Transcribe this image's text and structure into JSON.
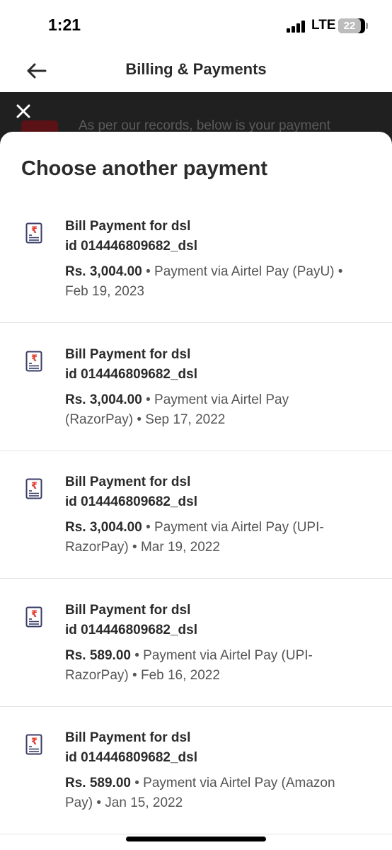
{
  "status": {
    "time": "1:21",
    "network": "LTE",
    "battery": "22"
  },
  "header": {
    "title": "Billing & Payments"
  },
  "banner": {
    "text": "As per our records, below is your payment"
  },
  "sheet": {
    "title": "Choose another payment",
    "items": [
      {
        "title1": "Bill Payment for dsl",
        "title2": "id 014446809682_dsl",
        "amount": "Rs. 3,004.00",
        "line1": " • Payment via Airtel Pay (PayU) •",
        "line2": "Feb 19, 2023"
      },
      {
        "title1": "Bill Payment for dsl",
        "title2": "id 014446809682_dsl",
        "amount": "Rs. 3,004.00",
        "line1": " • Payment via Airtel Pay",
        "line2": "(RazorPay) • Sep 17, 2022"
      },
      {
        "title1": "Bill Payment for dsl",
        "title2": "id 014446809682_dsl",
        "amount": "Rs. 3,004.00",
        "line1": " • Payment via Airtel Pay (UPI-",
        "line2": "RazorPay) • Mar 19, 2022"
      },
      {
        "title1": "Bill Payment for dsl",
        "title2": "id 014446809682_dsl",
        "amount": "Rs. 589.00",
        "line1": " • Payment via Airtel Pay (UPI-",
        "line2": "RazorPay) • Feb 16, 2022"
      },
      {
        "title1": "Bill Payment for dsl",
        "title2": "id 014446809682_dsl",
        "amount": "Rs. 589.00",
        "line1": " • Payment via Airtel Pay (Amazon",
        "line2": "Pay) • Jan 15, 2022"
      }
    ]
  },
  "icons": {
    "back": "arrow-left-icon",
    "close": "close-icon",
    "bill": "rupee-bill-icon"
  },
  "colors": {
    "accent": "#e33b2e",
    "dark_band": "#202020",
    "icon_ink": "#3a3d66"
  }
}
